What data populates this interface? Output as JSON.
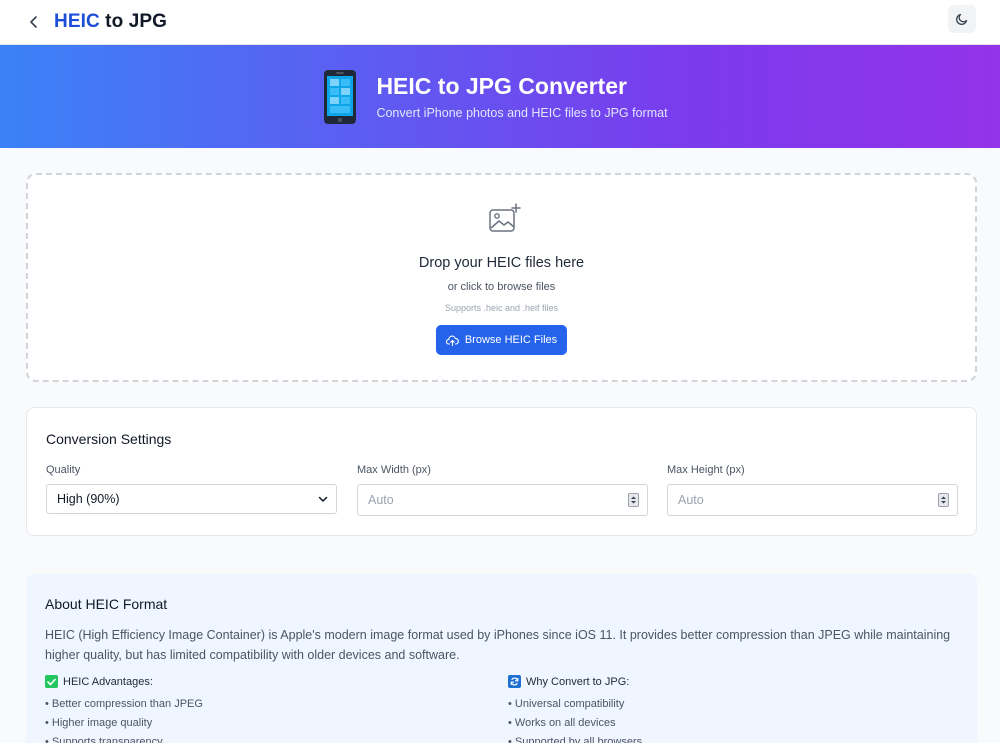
{
  "header": {
    "title_accent": "HEIC",
    "title_rest": " to JPG",
    "back_icon": "chevron-left-icon",
    "theme_icon": "moon-icon"
  },
  "hero": {
    "title": "HEIC to JPG Converter",
    "subtitle": "Convert iPhone photos and HEIC files to JPG format",
    "icon": "mobile-phone-icon"
  },
  "dropzone": {
    "title": "Drop your HEIC files here",
    "or_text": "or click to browse files",
    "supports": "Supports .heic and .heif files",
    "button_label": "Browse HEIC Files"
  },
  "settings": {
    "title": "Conversion Settings",
    "quality_label": "Quality",
    "quality_value": "High (90%)",
    "max_width_label": "Max Width (px)",
    "max_width_placeholder": "Auto",
    "max_height_label": "Max Height (px)",
    "max_height_placeholder": "Auto"
  },
  "about": {
    "title": "About HEIC Format",
    "text": "HEIC (High Efficiency Image Container) is Apple's modern image format used by iPhones since iOS 11. It provides better compression than JPEG while maintaining higher quality, but has limited compatibility with older devices and software.",
    "advantages": {
      "title": "HEIC Advantages:",
      "items": [
        "Better compression than JPEG",
        "Higher image quality",
        "Supports transparency"
      ]
    },
    "why": {
      "title": "Why Convert to JPG:",
      "items": [
        "Universal compatibility",
        "Works on all devices",
        "Supported by all browsers"
      ]
    }
  },
  "colors": {
    "accent": "#2563eb",
    "hero_start": "#3b82f6",
    "hero_end": "#9333ea"
  }
}
